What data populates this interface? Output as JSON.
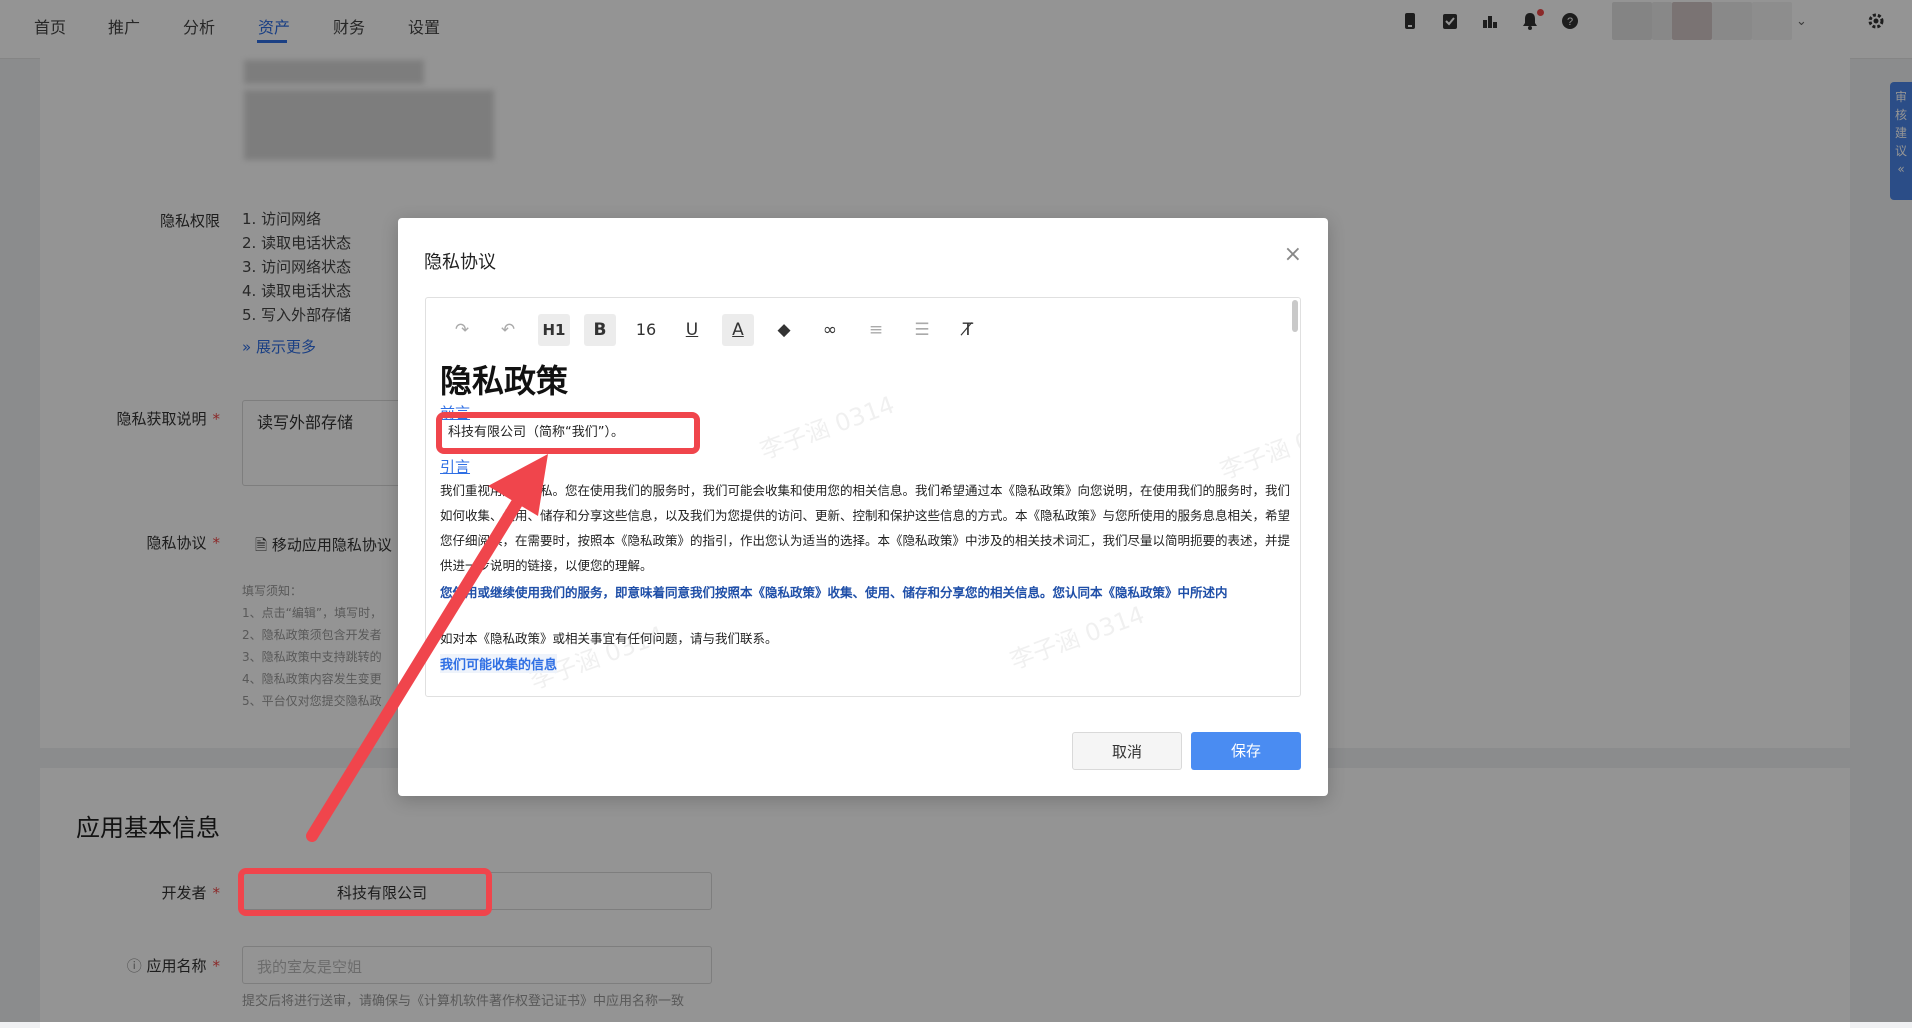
{
  "nav": {
    "tabs": [
      "首页",
      "推广",
      "分析",
      "资产",
      "财务",
      "设置"
    ],
    "active_tab": "资产",
    "icons": [
      "mobile-icon",
      "clipboard-icon",
      "chart-icon",
      "bell-icon",
      "help-icon",
      "settings-icon"
    ]
  },
  "form": {
    "privacy_perm_label": "隐私权限",
    "permissions": [
      "1. 访问网络",
      "2. 读取电话状态",
      "3. 访问网络状态",
      "4. 读取电话状态",
      "5. 写入外部存储"
    ],
    "show_more": "展示更多",
    "privacy_desc_label": "隐私获取说明",
    "privacy_desc_value": "读写外部存储",
    "privacy_agreement_label": "隐私协议",
    "privacy_agreement_file": "移动应用隐私协议",
    "notes_title": "填写须知：",
    "notes": [
      "1、点击“编辑”，填写时，",
      "2、隐私政策须包含开发者",
      "3、隐私政策中支持跳转的",
      "4、隐私政策内容发生变更",
      "5、平台仅对您提交隐私政"
    ]
  },
  "basic_info": {
    "title": "应用基本信息",
    "developer_label": "开发者",
    "developer_value": "科技有限公司",
    "app_name_label": "应用名称",
    "app_name_placeholder": "我的室友是空姐",
    "hint": "提交后将进行送审，请确保与《计算机软件著作权登记证书》中应用名称一致"
  },
  "side_tab": {
    "label": "审核建议 «"
  },
  "modal": {
    "title": "隐私协议",
    "close": "×",
    "toolbar": {
      "redo": "↷",
      "undo": "↶",
      "heading": "H1",
      "bold": "B",
      "font_size": "16",
      "underline": "U",
      "font_color": "A",
      "fill": "◆",
      "link": "∞",
      "align_left": "≡",
      "align_center": "☰",
      "clear": "T̸"
    },
    "doc": {
      "h1": "隐私政策",
      "intro_heading": "前言",
      "company_line": "科技有限公司（简称“我们”）。",
      "preface_heading": "引言",
      "para1": "我们重视用户的隐私。您在使用我们的服务时，我们可能会收集和使用您的相关信息。我们希望通过本《隐私政策》向您说明，在使用我们的服务时，我们如何收集、使用、储存和分享这些信息，以及我们为您提供的访问、更新、控制和保护这些信息的方式。本《隐私政策》与您所使用的服务息息相关，希望您仔细阅读，在需要时，按照本《隐私政策》的指引，作出您认为适当的选择。本《隐私政策》中涉及的相关技术词汇，我们尽量以简明扼要的表述，并提供进一步说明的链接，以便您的理解。",
      "para2": "您使用或继续使用我们的服务，即意味着同意我们按照本《隐私政策》收集、使用、储存和分享您的相关信息。您认同本《隐私政策》中所述内",
      "para3": "如对本《隐私政策》或相关事宜有任何问题，请与我们联系。",
      "collect_heading": "我们可能收集的信息",
      "watermark": "李子涵 0314"
    },
    "cancel": "取消",
    "save": "保存"
  },
  "colors": {
    "accent": "#2f6fe4",
    "annotation_red": "#f0454c",
    "save_btn": "#4a8cf2"
  }
}
